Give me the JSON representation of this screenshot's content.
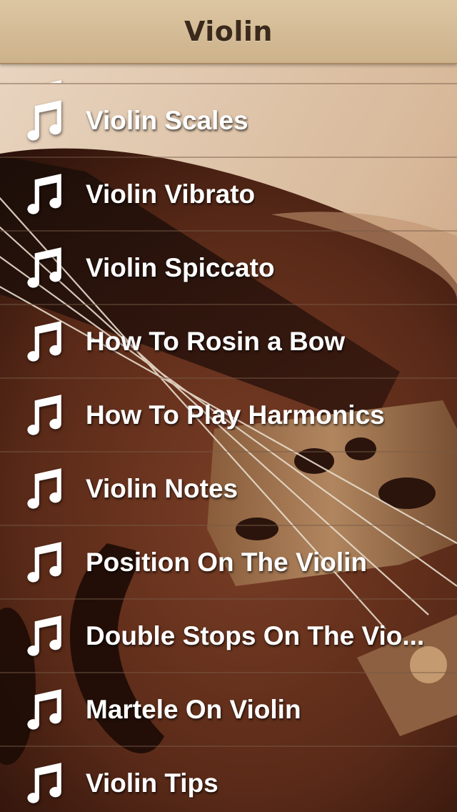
{
  "nav": {
    "title": "Violin"
  },
  "list": {
    "row_icon": "music-note-icon",
    "items": [
      "Violin Scales",
      "Violin Vibrato",
      "Violin Spiccato",
      "How To Rosin a Bow",
      "How To Play Harmonics",
      "Violin Notes",
      "Position On The Violin",
      "Double Stops On The Vio...",
      "Martele On Violin",
      "Violin Tips"
    ]
  },
  "colors": {
    "nav_background": "#d5bc96",
    "nav_title": "#3b2a1c",
    "label_text": "#ffffff",
    "row_divider": "#78594a"
  }
}
